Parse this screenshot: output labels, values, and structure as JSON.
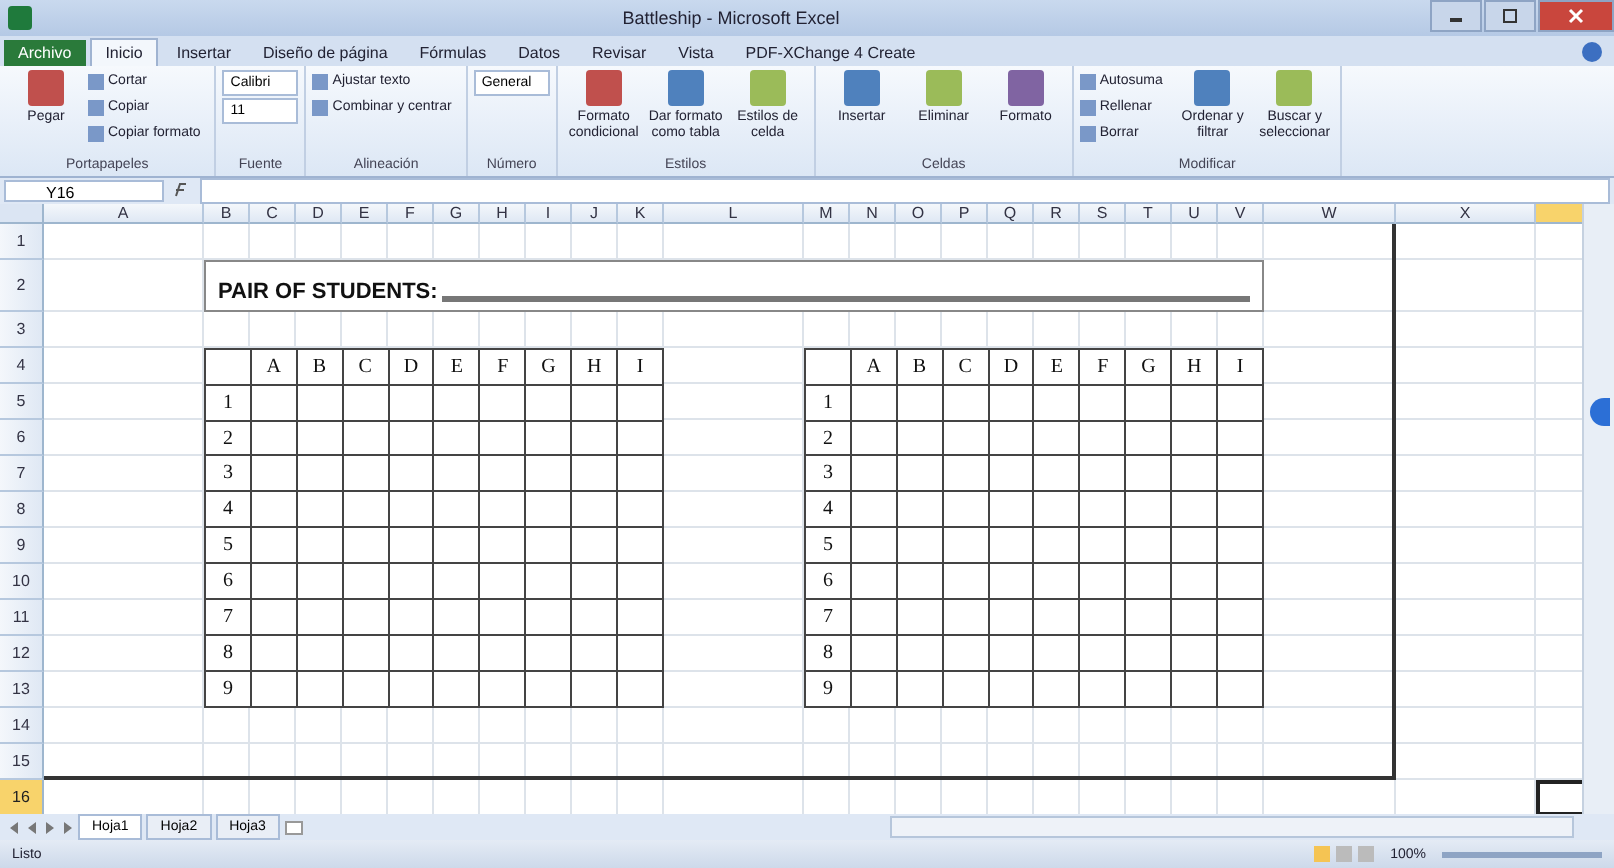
{
  "window": {
    "title": "Battleship - Microsoft Excel"
  },
  "ribbon": {
    "tabs": [
      {
        "label": "Archivo",
        "kind": "file",
        "selected": false
      },
      {
        "label": "Inicio",
        "kind": "tab",
        "selected": true
      },
      {
        "label": "Insertar",
        "kind": "tab",
        "selected": false
      },
      {
        "label": "Diseño de página",
        "kind": "tab",
        "selected": false
      },
      {
        "label": "Fórmulas",
        "kind": "tab",
        "selected": false
      },
      {
        "label": "Datos",
        "kind": "tab",
        "selected": false
      },
      {
        "label": "Revisar",
        "kind": "tab",
        "selected": false
      },
      {
        "label": "Vista",
        "kind": "tab",
        "selected": false
      },
      {
        "label": "PDF-XChange 4 Create",
        "kind": "tab",
        "selected": false
      }
    ],
    "groups": [
      {
        "label": "Portapapeles",
        "items": [
          {
            "kind": "large",
            "label": "Pegar"
          },
          {
            "kind": "small",
            "label": "Cortar"
          },
          {
            "kind": "small",
            "label": "Copiar"
          },
          {
            "kind": "small",
            "label": "Copiar formato"
          }
        ]
      },
      {
        "label": "Fuente",
        "items": [
          {
            "kind": "combo",
            "label": "Calibri"
          },
          {
            "kind": "combo",
            "label": "11"
          }
        ]
      },
      {
        "label": "Alineación",
        "items": [
          {
            "kind": "small",
            "label": "Ajustar texto"
          },
          {
            "kind": "small",
            "label": "Combinar y centrar"
          }
        ]
      },
      {
        "label": "Número",
        "items": [
          {
            "kind": "combo",
            "label": "General"
          }
        ]
      },
      {
        "label": "Estilos",
        "items": [
          {
            "kind": "large",
            "label": "Formato condicional"
          },
          {
            "kind": "large",
            "label": "Dar formato como tabla"
          },
          {
            "kind": "large",
            "label": "Estilos de celda"
          }
        ]
      },
      {
        "label": "Celdas",
        "items": [
          {
            "kind": "large",
            "label": "Insertar"
          },
          {
            "kind": "large",
            "label": "Eliminar"
          },
          {
            "kind": "large",
            "label": "Formato"
          }
        ]
      },
      {
        "label": "Modificar",
        "items": [
          {
            "kind": "small",
            "label": "Autosuma"
          },
          {
            "kind": "small",
            "label": "Rellenar"
          },
          {
            "kind": "small",
            "label": "Borrar"
          },
          {
            "kind": "large",
            "label": "Ordenar y filtrar"
          },
          {
            "kind": "large",
            "label": "Buscar y seleccionar"
          }
        ]
      }
    ]
  },
  "name_box": "Y16",
  "sheet": {
    "column_headers": [
      {
        "label": "A",
        "selected": false
      },
      {
        "label": "B",
        "selected": false
      },
      {
        "label": "C",
        "selected": false
      },
      {
        "label": "D",
        "selected": false
      },
      {
        "label": "E",
        "selected": false
      },
      {
        "label": "F",
        "selected": false
      },
      {
        "label": "G",
        "selected": false
      },
      {
        "label": "H",
        "selected": false
      },
      {
        "label": "I",
        "selected": false
      },
      {
        "label": "J",
        "selected": false
      },
      {
        "label": "K",
        "selected": false
      },
      {
        "label": "L",
        "selected": false
      },
      {
        "label": "M",
        "selected": false
      },
      {
        "label": "N",
        "selected": false
      },
      {
        "label": "O",
        "selected": false
      },
      {
        "label": "P",
        "selected": false
      },
      {
        "label": "Q",
        "selected": false
      },
      {
        "label": "R",
        "selected": false
      },
      {
        "label": "S",
        "selected": false
      },
      {
        "label": "T",
        "selected": false
      },
      {
        "label": "U",
        "selected": false
      },
      {
        "label": "V",
        "selected": false
      },
      {
        "label": "W",
        "selected": false
      },
      {
        "label": "X",
        "selected": false
      },
      {
        "selected": true
      }
    ],
    "row_headers": [
      {
        "label": "1",
        "selected": false
      },
      {
        "label": "2",
        "selected": false
      },
      {
        "label": "3",
        "selected": false
      },
      {
        "label": "4",
        "selected": false
      },
      {
        "label": "5",
        "selected": false
      },
      {
        "label": "6",
        "selected": false
      },
      {
        "label": "7",
        "selected": false
      },
      {
        "label": "8",
        "selected": false
      },
      {
        "label": "9",
        "selected": false
      },
      {
        "label": "10",
        "selected": false
      },
      {
        "label": "11",
        "selected": false
      },
      {
        "label": "12",
        "selected": false
      },
      {
        "label": "13",
        "selected": false
      },
      {
        "label": "14",
        "selected": false
      },
      {
        "label": "15",
        "selected": false
      },
      {
        "label": "16",
        "selected": true
      }
    ],
    "title": "PAIR OF STUDENTS:",
    "grids": [
      {
        "columns": [
          "A",
          "B",
          "C",
          "D",
          "E",
          "F",
          "G",
          "H",
          "I"
        ],
        "rows": [
          "1",
          "2",
          "3",
          "4",
          "5",
          "6",
          "7",
          "8",
          "9"
        ]
      },
      {
        "columns": [
          "A",
          "B",
          "C",
          "D",
          "E",
          "F",
          "G",
          "H",
          "I"
        ],
        "rows": [
          "1",
          "2",
          "3",
          "4",
          "5",
          "6",
          "7",
          "8",
          "9"
        ]
      }
    ]
  },
  "sheet_tabs": [
    {
      "label": "Hoja1",
      "selected": true
    },
    {
      "label": "Hoja2",
      "selected": false
    },
    {
      "label": "Hoja3",
      "selected": false
    }
  ],
  "status_bar": {
    "status": "Listo",
    "zoom": "100%"
  }
}
